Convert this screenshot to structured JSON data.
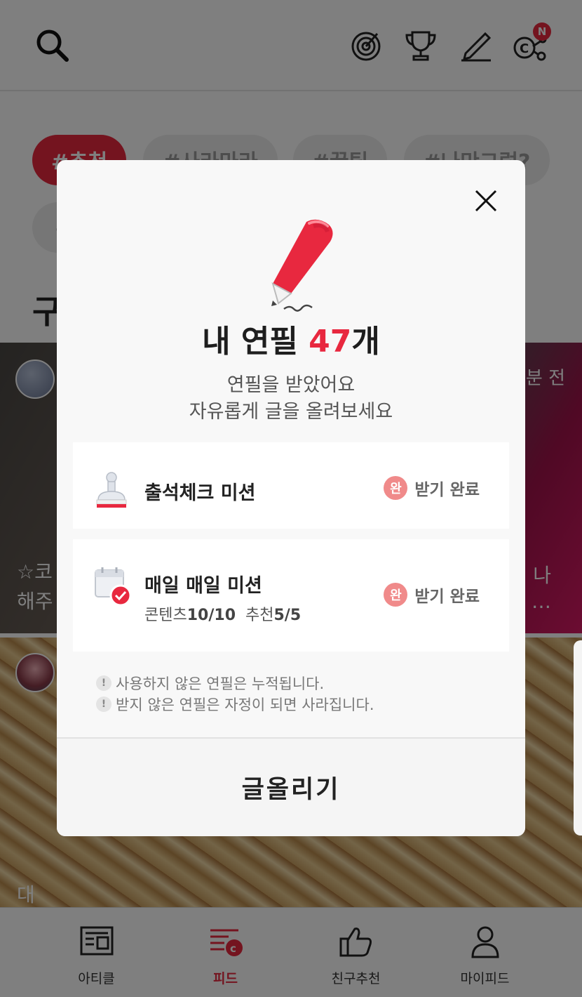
{
  "header": {
    "icons": [
      "search-icon",
      "target-icon",
      "trophy-icon",
      "pencil-icon",
      "coin-share-icon"
    ],
    "notification_badge": "N"
  },
  "tags": [
    {
      "label": "#추천",
      "active": true
    },
    {
      "label": "#사라마라",
      "active": false
    },
    {
      "label": "#꿀팁",
      "active": false
    },
    {
      "label": "#나만그럼?",
      "active": false
    },
    {
      "label": "#",
      "active": false
    }
  ],
  "section_title": "구",
  "feed": {
    "card1": {
      "time_ago": "분 전",
      "text_line1": "☆코",
      "text_line2": "해주",
      "more_line1": "나",
      "more_line2": "…"
    },
    "card2": {
      "text_line1": "대"
    }
  },
  "modal": {
    "title_prefix": "내 연필 ",
    "count": "47",
    "title_suffix": "개",
    "subtitle_line1": "연필을 받았어요",
    "subtitle_line2": "자유롭게 글을 올려보세요",
    "missions": [
      {
        "title": "출석체크 미션",
        "badge": "완",
        "status": "받기 완료"
      },
      {
        "title": "매일 매일 미션",
        "progress_label_1": "콘텐츠",
        "progress_value_1": "10/10",
        "progress_label_2": "추천",
        "progress_value_2": "5/5",
        "badge": "완",
        "status": "받기 완료"
      }
    ],
    "notes": [
      "사용하지 않은 연필은 누적됩니다.",
      "받지 않은 연필은 자정이 되면 사라집니다."
    ],
    "note_icon": "!",
    "write_button": "글올리기"
  },
  "bottom_nav": [
    {
      "label": "아티클",
      "icon": "article-icon",
      "active": false
    },
    {
      "label": "피드",
      "icon": "feed-icon",
      "active": true
    },
    {
      "label": "친구추천",
      "icon": "thumbs-up-icon",
      "active": false
    },
    {
      "label": "마이피드",
      "icon": "person-icon",
      "active": false
    }
  ],
  "colors": {
    "accent": "#e8283f",
    "done_badge": "#f08a8a",
    "modal_bg": "#f8f8f8"
  }
}
